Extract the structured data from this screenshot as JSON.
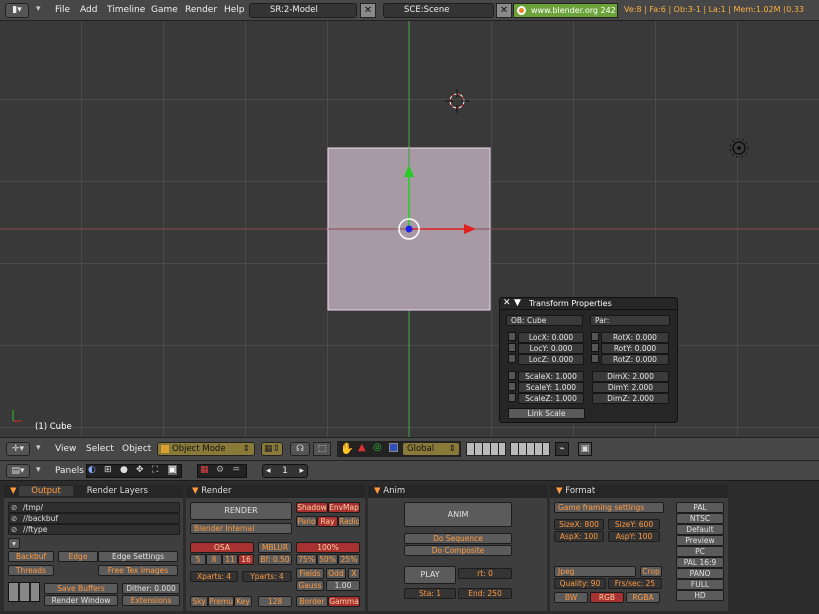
{
  "topbar": {
    "menus": [
      "File",
      "Add",
      "Timeline",
      "Game",
      "Render",
      "Help"
    ],
    "screen": "SR:2-Model",
    "scene": "SCE:Scene",
    "site": "www.blender.org 242",
    "stats": "Ve:8 | Fa:6 | Ob:3-1 | La:1  | Mem:1.02M (0.33"
  },
  "viewport": {
    "object_label": "(1) Cube"
  },
  "transform": {
    "title": "Transform Properties",
    "ob": "OB: Cube",
    "par": "Par:",
    "loc": [
      "LocX: 0.000",
      "LocY: 0.000",
      "LocZ: 0.000"
    ],
    "rot": [
      "RotX: 0.000",
      "RotY: 0.000",
      "RotZ: 0.000"
    ],
    "scale": [
      "ScaleX: 1.000",
      "ScaleY: 1.000",
      "ScaleZ: 1.000"
    ],
    "dim": [
      "DimX: 2.000",
      "DimY: 2.000",
      "DimZ: 2.000"
    ],
    "link": "Link Scale"
  },
  "header3d": {
    "view": "View",
    "select": "Select",
    "object": "Object",
    "mode": "Object Mode",
    "orientation": "Global"
  },
  "buttons": {
    "panels": "Panels",
    "frame": "1"
  },
  "output": {
    "tab1": "Output",
    "tab2": "Render Layers",
    "paths": [
      "/tmp/",
      "//backbuf",
      "//ftype"
    ],
    "backbuf": "Backbuf",
    "edge": "Edge",
    "edge_settings": "Edge Settings",
    "threads": "Threads",
    "free_tex": "Free Tex Images",
    "save_buffers": "Save Buffers",
    "dither": "Dither: 0.000",
    "render_window": "Render Window",
    "extensions": "Extensions"
  },
  "render": {
    "title": "Render",
    "render_btn": "RENDER",
    "shadow": "Shadow",
    "envmap": "EnvMap",
    "engine": "Blender Internal",
    "pano": "Pano",
    "ray": "Ray",
    "radio": "Radio",
    "osa": "OSA",
    "mblur": "MBLUR",
    "pct100": "100%",
    "osa_vals": [
      "5",
      "8",
      "11",
      "16"
    ],
    "bf": "Bf: 0.50",
    "pcts": [
      "75%",
      "50%",
      "25%"
    ],
    "xparts": "Xparts: 4",
    "yparts": "Yparts: 4",
    "fields": "Fields",
    "odd": "Odd",
    "x": "X",
    "gauss": "Gauss",
    "gauss_val": "1.00",
    "sky": "Sky",
    "premul": "Premul",
    "key": "Key",
    "n128": "128",
    "border": "Border",
    "gamma": "Gamma"
  },
  "anim": {
    "title": "Anim",
    "anim_btn": "ANIM",
    "do_seq": "Do Sequence",
    "do_comp": "Do Composite",
    "play": "PLAY",
    "rt": "rt: 0",
    "sta": "Sta: 1",
    "end": "End: 250"
  },
  "format": {
    "title": "Format",
    "game_framing": "Game framing settings",
    "sizex": "SizeX: 800",
    "sizey": "SizeY: 600",
    "aspx": "AspX: 100",
    "aspy": "AspY: 100",
    "codec": "Jpeg",
    "crop": "Crop",
    "quality": "Quality: 90",
    "frs": "Frs/sec: 25",
    "bw": "BW",
    "rgb": "RGB",
    "rgba": "RGBA",
    "presets": [
      "PAL",
      "NTSC",
      "Default",
      "Preview",
      "PC",
      "PAL 16:9",
      "PANO",
      "FULL",
      "HD"
    ]
  }
}
